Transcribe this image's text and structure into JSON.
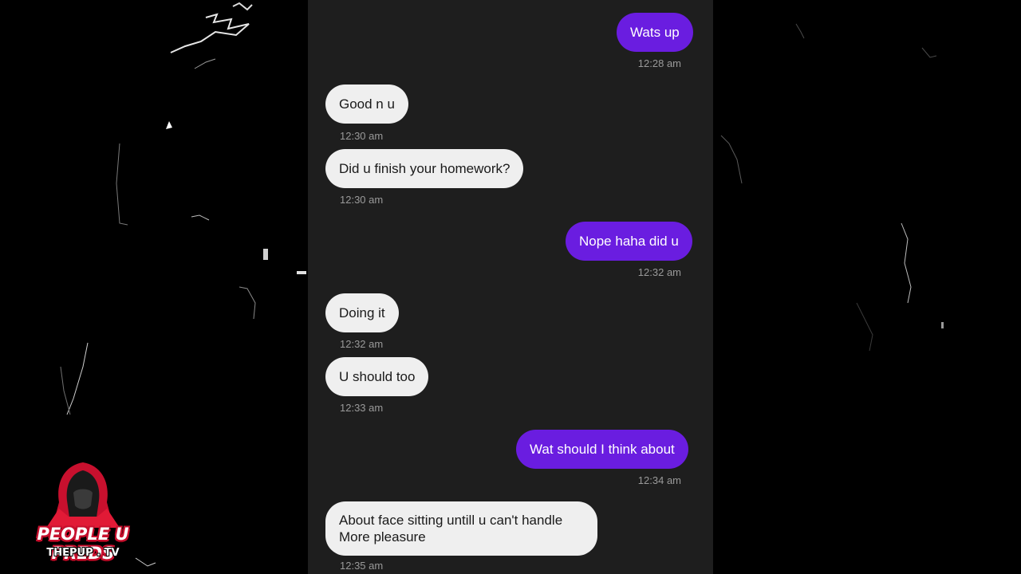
{
  "messages": [
    {
      "dir": "out",
      "text": "Wats up",
      "time": "12:28 am"
    },
    {
      "dir": "in",
      "text": "Good n u",
      "time": "12:30 am"
    },
    {
      "dir": "in",
      "text": "Did u finish your homework?",
      "time": "12:30 am"
    },
    {
      "dir": "out",
      "text": "Nope haha did u",
      "time": "12:32 am"
    },
    {
      "dir": "in",
      "text": "Doing it",
      "time": "12:32 am"
    },
    {
      "dir": "in",
      "text": "U should too",
      "time": "12:33 am"
    },
    {
      "dir": "out",
      "text": "Wat should I think about",
      "time": "12:34 am"
    },
    {
      "dir": "in",
      "text": "About face sitting untill u can't handle",
      "text2": "More pleasure",
      "time": "12:35 am"
    }
  ],
  "logo": {
    "title": "PEOPLE U PREDS",
    "site": "THEPUP . TV"
  },
  "colors": {
    "outgoing_bubble": "#6a1de0",
    "incoming_bubble": "#efefef",
    "chat_background": "#1e1e1e",
    "logo_red": "#c8102e"
  }
}
